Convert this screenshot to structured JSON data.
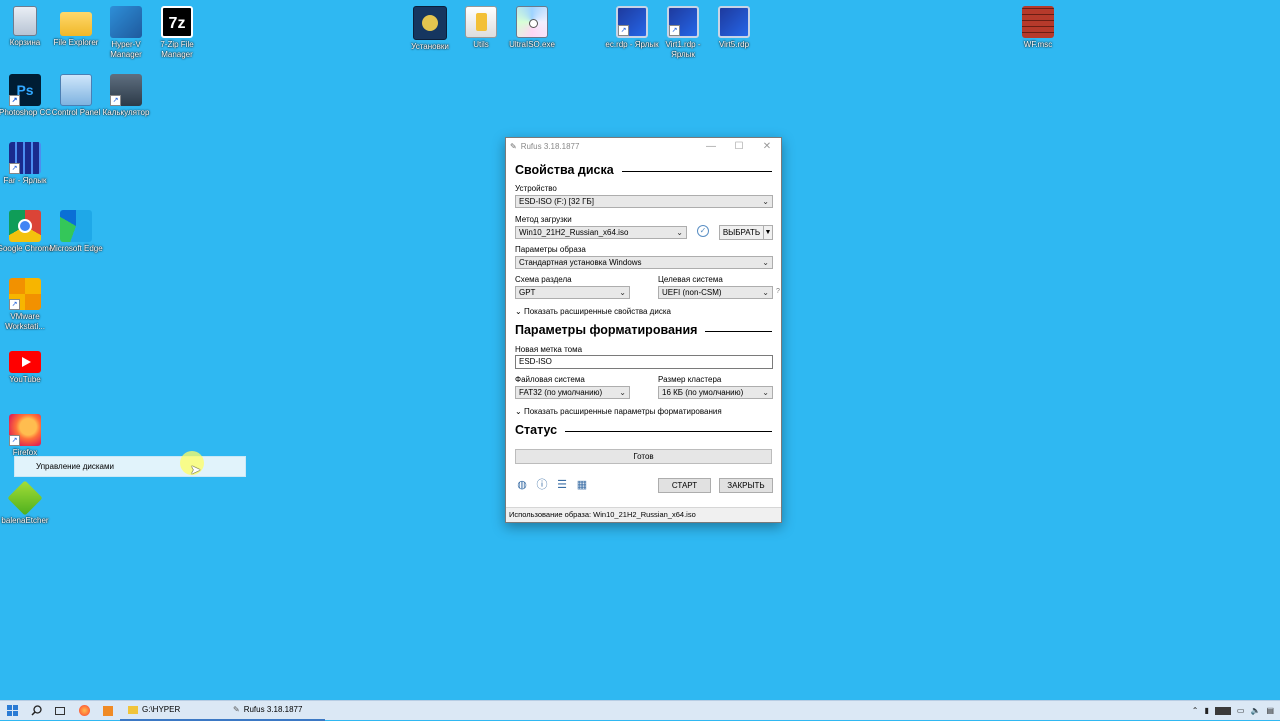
{
  "desktop": {
    "icons": [
      {
        "label": "Корзина",
        "icon": "recycle-bin-icon"
      },
      {
        "label": "File Explorer",
        "icon": "folder-icon"
      },
      {
        "label": "Hyper-V Manager",
        "icon": "hyperv-icon"
      },
      {
        "label": "7-Zip File Manager",
        "icon": "sevenzip-icon"
      },
      {
        "label": "Photoshop CC",
        "icon": "photoshop-icon"
      },
      {
        "label": "Control Panel",
        "icon": "control-panel-icon"
      },
      {
        "label": "Калькулятор",
        "icon": "calculator-icon"
      },
      {
        "label": "Far - Ярлык",
        "icon": "far-icon"
      },
      {
        "label": "Google Chrome",
        "icon": "chrome-icon"
      },
      {
        "label": "Microsoft Edge",
        "icon": "edge-icon"
      },
      {
        "label": "VMware Workstati...",
        "icon": "vmware-icon"
      },
      {
        "label": "YouTube",
        "icon": "youtube-icon"
      },
      {
        "label": "Firefox",
        "icon": "firefox-icon"
      },
      {
        "label": "balenaEtcher",
        "icon": "etcher-icon"
      },
      {
        "label": "Установки",
        "icon": "installs-icon"
      },
      {
        "label": "Utils",
        "icon": "utils-icon"
      },
      {
        "label": "UltraISO.exe",
        "icon": "ultraiso-icon"
      },
      {
        "label": "ec.rdp - Ярлык",
        "icon": "rdp-icon"
      },
      {
        "label": "Virt1.rdp - Ярлык",
        "icon": "rdp-icon"
      },
      {
        "label": "Virt5.rdp",
        "icon": "rdp-icon"
      },
      {
        "label": "WF.msc",
        "icon": "firewall-icon"
      }
    ],
    "context_item": "Управление дисками"
  },
  "rufus": {
    "title": "Rufus 3.18.1877",
    "section_drive": "Свойства диска",
    "device_label": "Устройство",
    "device_value": "ESD-ISO (F:) [32 ГБ]",
    "boot_label": "Метод загрузки",
    "boot_value": "Win10_21H2_Russian_x64.iso",
    "select_button": "ВЫБРАТЬ",
    "image_opts_label": "Параметры образа",
    "image_opts_value": "Стандартная установка Windows",
    "partition_label": "Схема раздела",
    "partition_value": "GPT",
    "target_label": "Целевая система",
    "target_value": "UEFI (non-CSM)",
    "help_mark": "?",
    "adv_drive": "Показать расширенные свойства диска",
    "section_format": "Параметры форматирования",
    "volume_label": "Новая метка тома",
    "volume_value": "ESD-ISO",
    "fs_label": "Файловая система",
    "fs_value": "FAT32 (по умолчанию)",
    "cluster_label": "Размер кластера",
    "cluster_value": "16 КБ (по умолчанию)",
    "adv_format": "Показать расширенные параметры форматирования",
    "section_status": "Статус",
    "status_text": "Готов",
    "start_button": "СТАРТ",
    "close_button": "ЗАКРЫТЬ",
    "statusbar": "Использование образа: Win10_21H2_Russian_x64.iso"
  },
  "taskbar": {
    "explorer_item": "G:\\HYPER",
    "rufus_item": "Rufus 3.18.1877"
  },
  "colors": {
    "desktop_bg": "#2fb8f2",
    "taskbar_bg": "#dbe8f5"
  }
}
